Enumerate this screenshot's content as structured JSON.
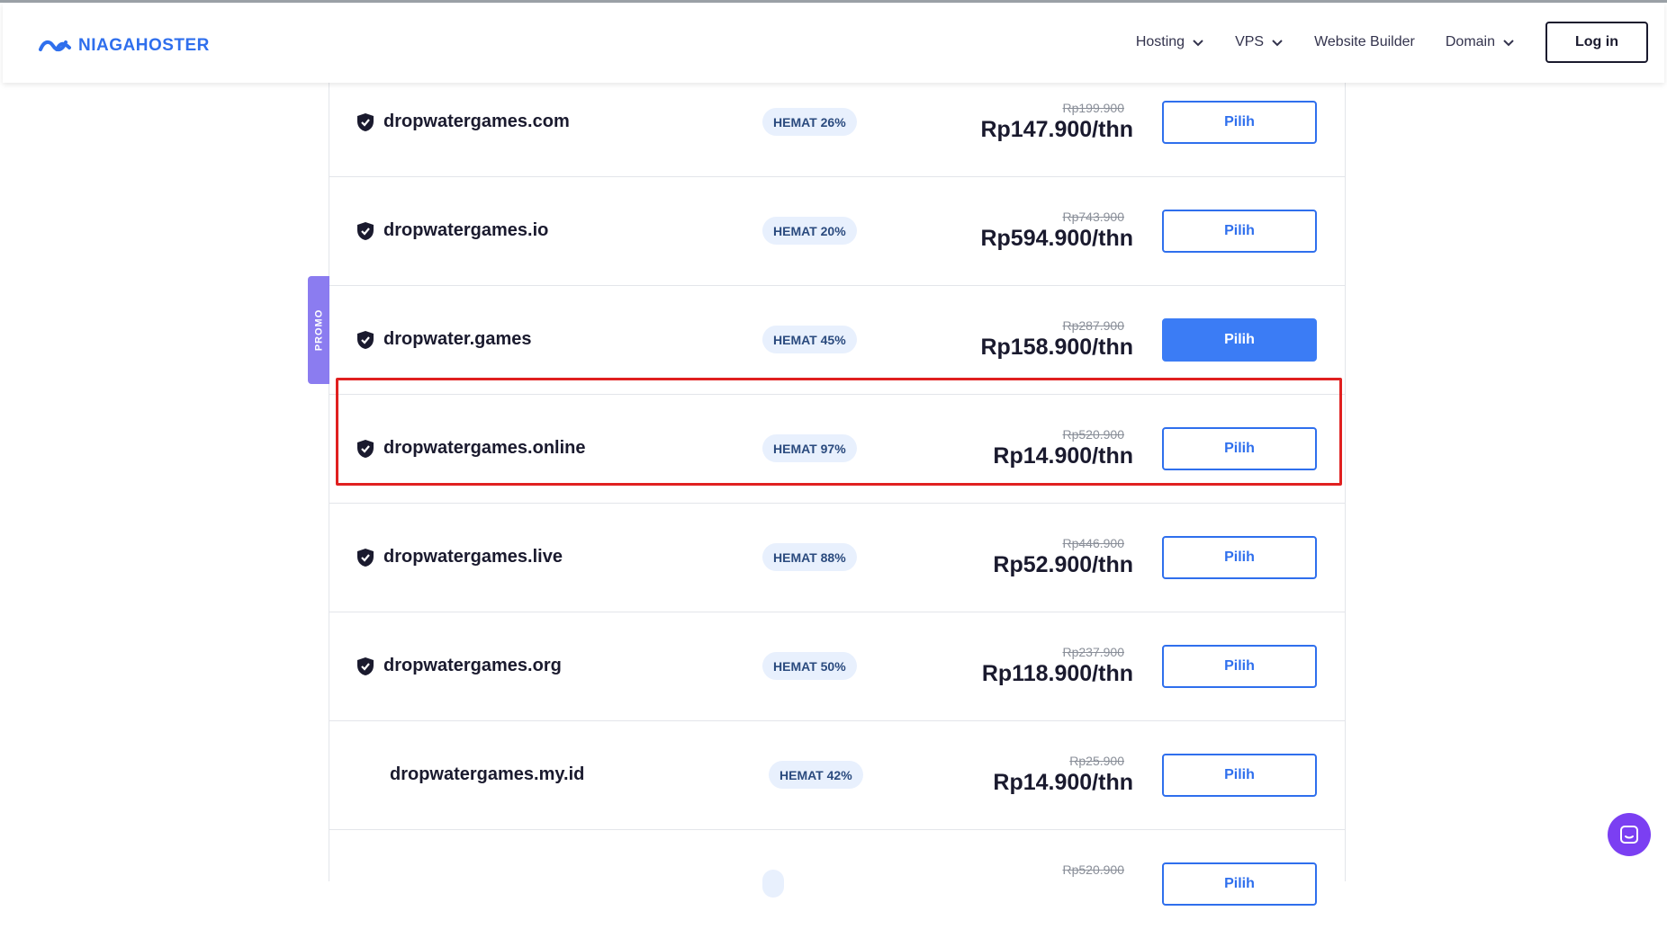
{
  "header": {
    "brand": "NIAGAHOSTER",
    "nav": [
      {
        "label": "Hosting",
        "dropdown": true
      },
      {
        "label": "VPS",
        "dropdown": true
      },
      {
        "label": "Website Builder",
        "dropdown": false
      },
      {
        "label": "Domain",
        "dropdown": true
      }
    ],
    "login_label": "Log in"
  },
  "promo_label": "PROMO",
  "button_label": "Pilih",
  "domains": [
    {
      "name": "dropwatergames.com",
      "badge": "HEMAT 26%",
      "old_price": "Rp199.900",
      "price": "Rp147.900/thn",
      "shield": true,
      "selected": false
    },
    {
      "name": "dropwatergames.io",
      "badge": "HEMAT 20%",
      "old_price": "Rp743.900",
      "price": "Rp594.900/thn",
      "shield": true,
      "selected": false
    },
    {
      "name": "dropwater.games",
      "badge": "HEMAT 45%",
      "old_price": "Rp287.900",
      "price": "Rp158.900/thn",
      "shield": true,
      "selected": true
    },
    {
      "name": "dropwatergames.online",
      "badge": "HEMAT 97%",
      "old_price": "Rp520.900",
      "price": "Rp14.900/thn",
      "shield": true,
      "selected": false
    },
    {
      "name": "dropwatergames.live",
      "badge": "HEMAT 88%",
      "old_price": "Rp446.900",
      "price": "Rp52.900/thn",
      "shield": true,
      "selected": false
    },
    {
      "name": "dropwatergames.org",
      "badge": "HEMAT 50%",
      "old_price": "Rp237.900",
      "price": "Rp118.900/thn",
      "shield": true,
      "selected": false
    },
    {
      "name": "dropwatergames.my.id",
      "badge": "HEMAT 42%",
      "old_price": "Rp25.900",
      "price": "Rp14.900/thn",
      "shield": false,
      "selected": false
    },
    {
      "name": "",
      "badge": "",
      "old_price": "Rp520.900",
      "price": "",
      "shield": false,
      "selected": false
    }
  ],
  "colors": {
    "brand": "#2f6fed",
    "promo": "#8b7cf0",
    "highlight": "#e02020",
    "chat": "#7b3ff2"
  }
}
